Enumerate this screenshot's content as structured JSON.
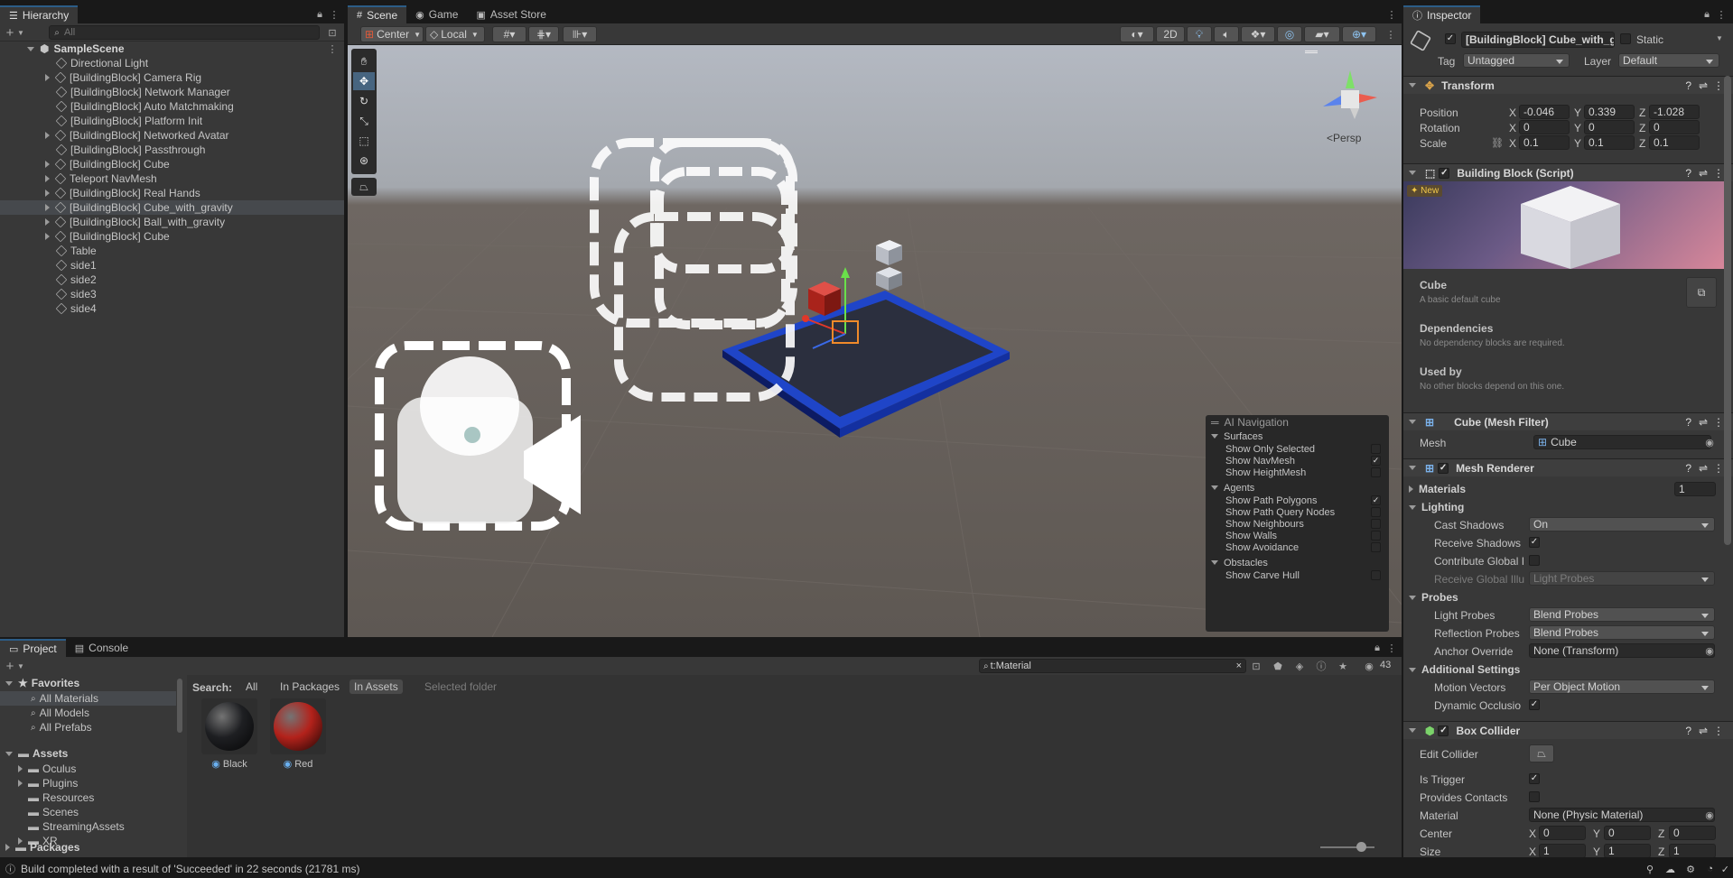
{
  "tabs": {
    "hierarchy": "Hierarchy",
    "scene": "Scene",
    "game": "Game",
    "asset_store": "Asset Store",
    "inspector": "Inspector",
    "project": "Project",
    "console": "Console"
  },
  "hierarchy": {
    "search_placeholder": "All",
    "scene_name": "SampleScene",
    "items": [
      {
        "label": "Directional Light",
        "expandable": false
      },
      {
        "label": "[BuildingBlock] Camera Rig",
        "expandable": true
      },
      {
        "label": "[BuildingBlock] Network Manager",
        "expandable": false
      },
      {
        "label": "[BuildingBlock] Auto Matchmaking",
        "expandable": false
      },
      {
        "label": "[BuildingBlock] Platform Init",
        "expandable": false
      },
      {
        "label": "[BuildingBlock] Networked Avatar",
        "expandable": true
      },
      {
        "label": "[BuildingBlock] Passthrough",
        "expandable": false
      },
      {
        "label": "[BuildingBlock] Cube",
        "expandable": true
      },
      {
        "label": "Teleport NavMesh",
        "expandable": true
      },
      {
        "label": "[BuildingBlock] Real Hands",
        "expandable": true
      },
      {
        "label": "[BuildingBlock] Cube_with_gravity",
        "expandable": true,
        "selected": true
      },
      {
        "label": "[BuildingBlock] Ball_with_gravity",
        "expandable": true
      },
      {
        "label": "[BuildingBlock] Cube",
        "expandable": true
      },
      {
        "label": "Table",
        "expandable": false
      },
      {
        "label": "side1",
        "expandable": false
      },
      {
        "label": "side2",
        "expandable": false
      },
      {
        "label": "side3",
        "expandable": false
      },
      {
        "label": "side4",
        "expandable": false
      }
    ]
  },
  "scene_toolbar": {
    "pivot": "Center",
    "space": "Local",
    "mode_2d": "2D",
    "persp": "Persp"
  },
  "ai_navigation": {
    "title": "AI Navigation",
    "groups": [
      {
        "name": "Surfaces",
        "items": [
          {
            "label": "Show Only Selected",
            "checked": false
          },
          {
            "label": "Show NavMesh",
            "checked": true
          },
          {
            "label": "Show HeightMesh",
            "checked": false
          }
        ]
      },
      {
        "name": "Agents",
        "items": [
          {
            "label": "Show Path Polygons",
            "checked": true
          },
          {
            "label": "Show Path Query Nodes",
            "checked": false
          },
          {
            "label": "Show Neighbours",
            "checked": false
          },
          {
            "label": "Show Walls",
            "checked": false
          },
          {
            "label": "Show Avoidance",
            "checked": false
          }
        ]
      },
      {
        "name": "Obstacles",
        "items": [
          {
            "label": "Show Carve Hull",
            "checked": false
          }
        ]
      }
    ]
  },
  "inspector": {
    "object_name": "[BuildingBlock] Cube_with_gravity",
    "static_label": "Static",
    "tag_label": "Tag",
    "tag_value": "Untagged",
    "layer_label": "Layer",
    "layer_value": "Default",
    "transform": {
      "title": "Transform",
      "position": {
        "label": "Position",
        "x": "-0.046",
        "y": "0.339",
        "z": "-1.028"
      },
      "rotation": {
        "label": "Rotation",
        "x": "0",
        "y": "0",
        "z": "0"
      },
      "scale": {
        "label": "Scale",
        "x": "0.1",
        "y": "0.1",
        "z": "0.1"
      }
    },
    "building_block": {
      "title": "Building Block (Script)",
      "new_badge": "New",
      "name": "Cube",
      "description": "A basic default cube",
      "dependencies_title": "Dependencies",
      "dependencies_text": "No dependency blocks are required.",
      "used_by_title": "Used by",
      "used_by_text": "No other blocks depend on this one."
    },
    "mesh_filter": {
      "title": "Cube (Mesh Filter)",
      "mesh_label": "Mesh",
      "mesh_value": "Cube"
    },
    "mesh_renderer": {
      "title": "Mesh Renderer",
      "materials_label": "Materials",
      "materials_count": "1",
      "lighting": "Lighting",
      "cast_shadows_label": "Cast Shadows",
      "cast_shadows_value": "On",
      "receive_shadows_label": "Receive Shadows",
      "receive_shadows": true,
      "contribute_gi_label": "Contribute Global I",
      "contribute_gi": false,
      "receive_gi_label": "Receive Global Illu",
      "receive_gi_value": "Light Probes",
      "probes": "Probes",
      "light_probes_label": "Light Probes",
      "light_probes_value": "Blend Probes",
      "reflection_probes_label": "Reflection Probes",
      "reflection_probes_value": "Blend Probes",
      "anchor_override_label": "Anchor Override",
      "anchor_override_value": "None (Transform)",
      "additional": "Additional Settings",
      "motion_vectors_label": "Motion Vectors",
      "motion_vectors_value": "Per Object Motion",
      "dynamic_occlusion_label": "Dynamic Occlusio",
      "dynamic_occlusion": true
    },
    "box_collider": {
      "title": "Box Collider",
      "edit_collider_label": "Edit Collider",
      "is_trigger_label": "Is Trigger",
      "is_trigger": true,
      "provides_contacts_label": "Provides Contacts",
      "provides_contacts": false,
      "material_label": "Material",
      "material_value": "None (Physic Material)",
      "center_label": "Center",
      "center_x": "0",
      "center_y": "0",
      "center_z": "0",
      "size_label": "Size",
      "size_x": "1",
      "size_y": "1",
      "size_z": "1"
    }
  },
  "project": {
    "search_value": "t:Material",
    "count": "43",
    "search_label": "Search:",
    "scope": [
      "All",
      "In Packages",
      "In Assets",
      "Selected folder"
    ],
    "favorites_title": "Favorites",
    "favorites": [
      "All Materials",
      "All Models",
      "All Prefabs"
    ],
    "assets_title": "Assets",
    "asset_folders": [
      "Oculus",
      "Plugins",
      "Resources",
      "Scenes",
      "StreamingAssets",
      "XR"
    ],
    "packages_title": "Packages",
    "materials": [
      {
        "name": "Black",
        "color": "#1e1f22"
      },
      {
        "name": "Red",
        "color": "#b3221b"
      }
    ]
  },
  "status_bar": {
    "message": "Build completed with a result of 'Succeeded' in 22 seconds (21781 ms)"
  },
  "colors": {
    "accent": "#2c5d87",
    "selection": "#46494d",
    "panel": "#383838"
  }
}
